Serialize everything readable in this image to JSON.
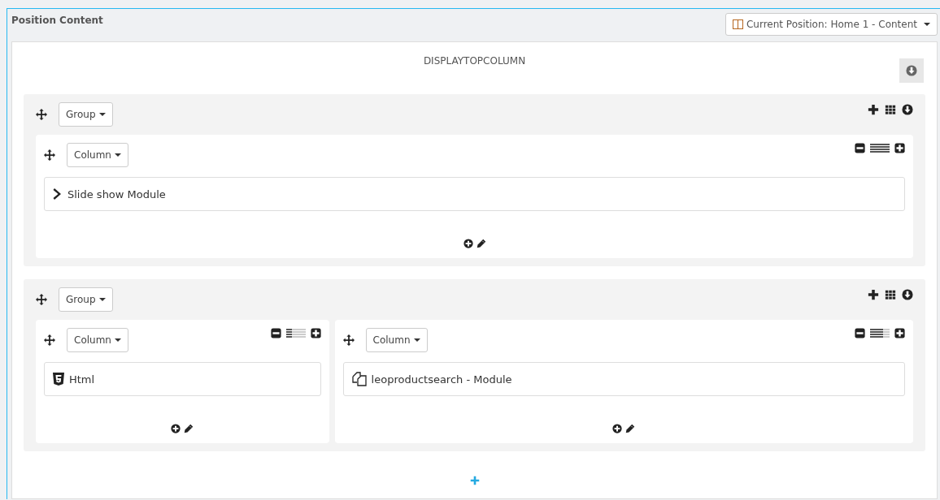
{
  "panel": {
    "title": "Position Content",
    "position_button": "Current Position: Home 1 - Content"
  },
  "position": {
    "name": "DISPLAYTOPCOLUMN"
  },
  "groups": [
    {
      "label": "Group",
      "columns": [
        {
          "label": "Column",
          "level": 1,
          "modules": [
            {
              "kind": "slideshow",
              "name": "Slide show Module"
            }
          ]
        }
      ]
    },
    {
      "label": "Group",
      "columns": [
        {
          "label": "Column",
          "level": 0.33,
          "modules": [
            {
              "kind": "html",
              "name": "Html"
            }
          ]
        },
        {
          "label": "Column",
          "level": 0.67,
          "modules": [
            {
              "kind": "module",
              "name": "leoproductsearch - Module"
            }
          ]
        }
      ]
    }
  ]
}
